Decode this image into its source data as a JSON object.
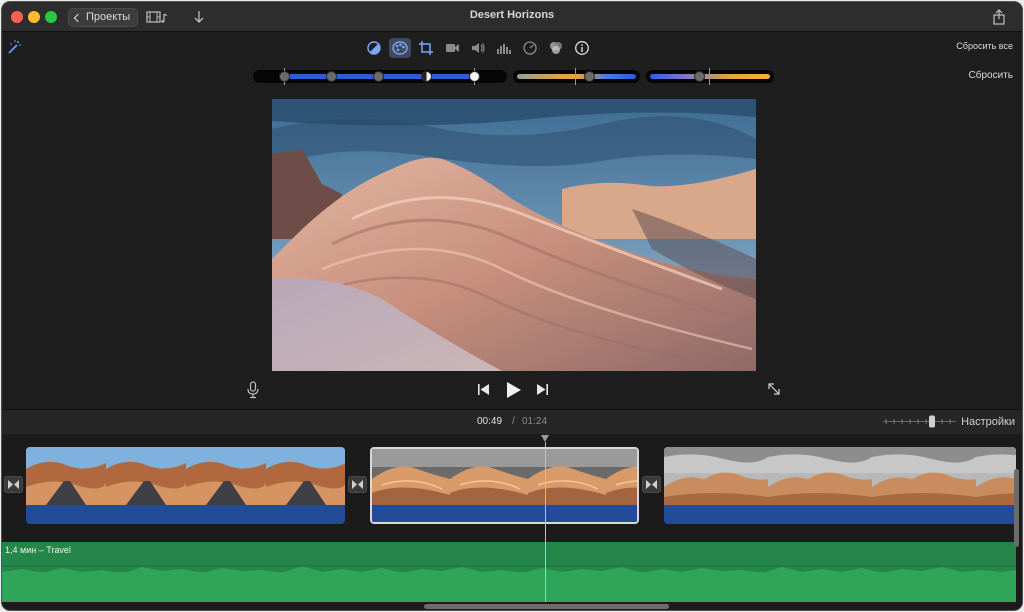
{
  "window": {
    "title": "Desert Horizons"
  },
  "toolbar": {
    "projects_label": "Проекты",
    "reset_all_label": "Сбросить все",
    "reset_label": "Сбросить",
    "tools": [
      "color-balance-icon",
      "color-correction-icon",
      "crop-icon",
      "stabilization-icon",
      "volume-icon",
      "noise-reduction-icon",
      "speed-icon",
      "clip-filter-icon",
      "info-icon"
    ],
    "active_tool": "color-correction-icon"
  },
  "playback": {
    "current_time": "00:49",
    "separator": "/",
    "total_time": "01:24"
  },
  "timeline": {
    "settings_label": "Настройки",
    "audio_label": "1,4 мин – Travel"
  },
  "colors": {
    "accent_blue": "#234b98",
    "audio_green": "#25864a",
    "active_tool_bg": "#3f4a5c"
  }
}
